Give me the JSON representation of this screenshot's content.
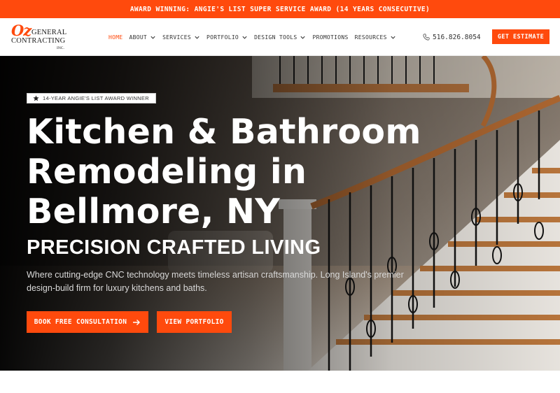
{
  "announcement": "AWARD WINNING: ANGIE'S LIST SUPER SERVICE AWARD (14 YEARS CONSECUTIVE)",
  "logo": {
    "mark": "Oz",
    "line1": "GENERAL",
    "line2": "CONTRACTING",
    "line3": "INC."
  },
  "nav": {
    "items": [
      {
        "label": "HOME",
        "dropdown": false,
        "active": true
      },
      {
        "label": "ABOUT",
        "dropdown": true
      },
      {
        "label": "SERVICES",
        "dropdown": true
      },
      {
        "label": "PORTFOLIO",
        "dropdown": true
      },
      {
        "label": "DESIGN TOOLS",
        "dropdown": true
      },
      {
        "label": "PROMOTIONS",
        "dropdown": false
      },
      {
        "label": "RESOURCES",
        "dropdown": true
      }
    ],
    "phone": "516.826.8054",
    "cta_label": "GET ESTIMATE"
  },
  "hero": {
    "badge": "14-YEAR ANGIE'S LIST AWARD WINNER",
    "title_line1": "Kitchen & Bathroom",
    "title_line2": "Remodeling in",
    "title_line3": "Bellmore, NY",
    "subtitle": "PRECISION CRAFTED LIVING",
    "description": "Where cutting-edge CNC technology meets timeless artisan craftsmanship. Long Island's premier design-build firm for luxury kitchens and baths.",
    "primary_button": "BOOK FREE CONSULTATION",
    "secondary_button": "VIEW PORTFOLIO"
  },
  "colors": {
    "accent": "#ff4a0d",
    "dark": "#1a1a1a",
    "white": "#ffffff"
  },
  "icons": {
    "badge": "star-icon",
    "phone": "phone-icon",
    "primary_button": "arrow-right-icon",
    "dropdown": "chevron-down-icon"
  }
}
